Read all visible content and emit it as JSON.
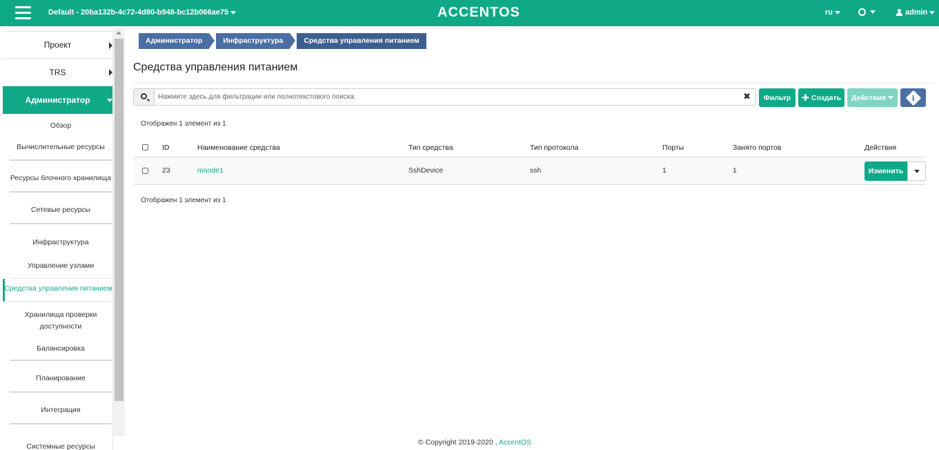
{
  "topbar": {
    "project": "Default - 20ba132b-4c72-4d80-b948-bc12b066ae75",
    "logo": "ACCENTOS",
    "language": "ru",
    "user": "admin",
    "accent_color": "#10a987"
  },
  "sidebar": {
    "top_items": [
      {
        "label": "Проект"
      },
      {
        "label": "TRS"
      }
    ],
    "active_section": "Администратор",
    "sub_items": [
      {
        "label": "Обзор"
      },
      {
        "label": "Вычислительные ресурсы"
      },
      {
        "label": "Ресурсы блочного хранилища"
      },
      {
        "label": "Сетевые ресурсы"
      },
      {
        "label": "Инфраструктура"
      },
      {
        "label": "Управление узлами"
      },
      {
        "label": "Средства управления питанием"
      },
      {
        "label": "Хранилища проверки доступности"
      },
      {
        "label": "Балансировка"
      },
      {
        "label": "Планирование"
      },
      {
        "label": "Интеграция"
      },
      {
        "label": "Системные ресурсы"
      }
    ]
  },
  "breadcrumb": [
    "Администратор",
    "Инфраструктура",
    "Средства управления питанием"
  ],
  "page_title": "Средства управления питанием",
  "search": {
    "placeholder": "Нажмите здесь для фильтрации или полнотекстового поиска.",
    "value": ""
  },
  "toolbar": {
    "filter_label": "Фильтр",
    "create_label": "Создать",
    "actions_label": "Действия",
    "info_label": "i"
  },
  "count_text": "Отображен 1 элемент из 1",
  "table": {
    "headers": [
      "ID",
      "Наименование средства",
      "Тип средства",
      "Тип протокола",
      "Порты",
      "Занято портов",
      "Действия"
    ],
    "rows": [
      {
        "id": "23",
        "name": "mnode1",
        "device_type": "SshDevice",
        "protocol": "ssh",
        "ports": "1",
        "used_ports": "1",
        "action": "Изменить"
      }
    ]
  },
  "footer": {
    "copyright": "© Copyright 2019-2020 ,",
    "brand": "AccentOS"
  }
}
